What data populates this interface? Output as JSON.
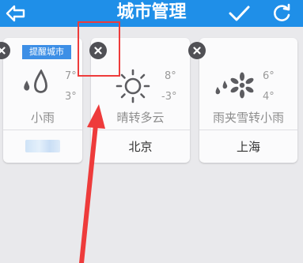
{
  "header": {
    "title": "城市管理",
    "back_icon": "back-arrow-icon",
    "confirm_icon": "checkmark-icon",
    "refresh_icon": "refresh-icon"
  },
  "cards": [
    {
      "badge": "提醒城市",
      "weather_icon": "light-rain-icon",
      "temp_high": "7°",
      "temp_low": "3°",
      "description": "小雨",
      "city": ""
    },
    {
      "weather_icon": "sunny-icon",
      "temp_high": "8°",
      "temp_low": "-3°",
      "description": "晴转多云",
      "city": "北京"
    },
    {
      "weather_icon": "sleet-icon",
      "temp_high": "6°",
      "temp_low": "4°",
      "description": "雨夹雪转小雨",
      "city": "上海"
    }
  ],
  "colors": {
    "header_bg": "#1f8fe8",
    "page_bg": "#e9e9ec",
    "badge_bg": "#3d8fe6",
    "delete_bg": "#505055",
    "annotation": "#ee3b3b"
  }
}
